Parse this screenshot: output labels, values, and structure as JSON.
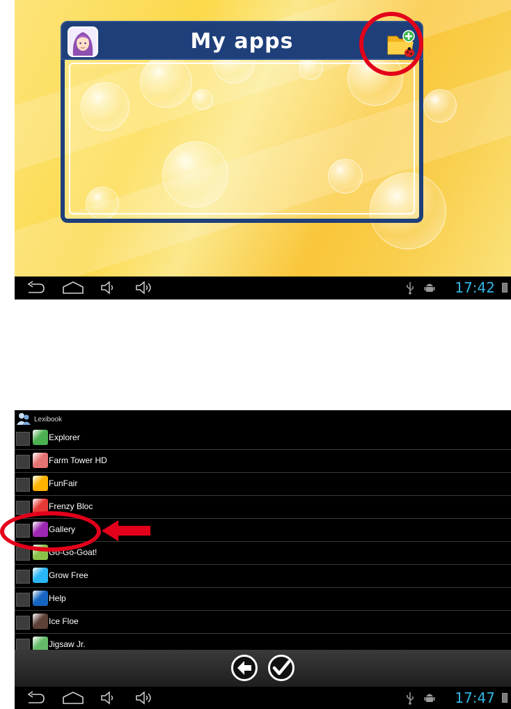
{
  "screen1": {
    "title": "My apps",
    "time": "17:42",
    "icons": [
      "avatar-icon",
      "add-folder-icon",
      "back-icon",
      "home-icon",
      "volume-down-icon",
      "volume-up-icon",
      "usb-icon",
      "android-debug-icon",
      "battery-icon"
    ]
  },
  "screen2": {
    "header_label": "Lexibook",
    "apps": [
      {
        "name": "Explorer",
        "color": "#4caf50"
      },
      {
        "name": "Farm Tower HD",
        "color": "#e57373"
      },
      {
        "name": "FunFair",
        "color": "#ffb300"
      },
      {
        "name": "Frenzy Bloc",
        "color": "#e53935"
      },
      {
        "name": "Gallery",
        "color": "#9c27b0"
      },
      {
        "name": "Go-Go-Goat!",
        "color": "#8bc34a"
      },
      {
        "name": "Grow Free",
        "color": "#29b6f6"
      },
      {
        "name": "Help",
        "color": "#1565c0"
      },
      {
        "name": "Ice Floe",
        "color": "#5d4037"
      },
      {
        "name": "Jigsaw Jr.",
        "color": "#66bb6a"
      }
    ],
    "time": "17:47"
  },
  "colors": {
    "panel_blue": "#1e3f7a",
    "annotation_red": "#e3001b",
    "clock_blue": "#33b5e5"
  }
}
